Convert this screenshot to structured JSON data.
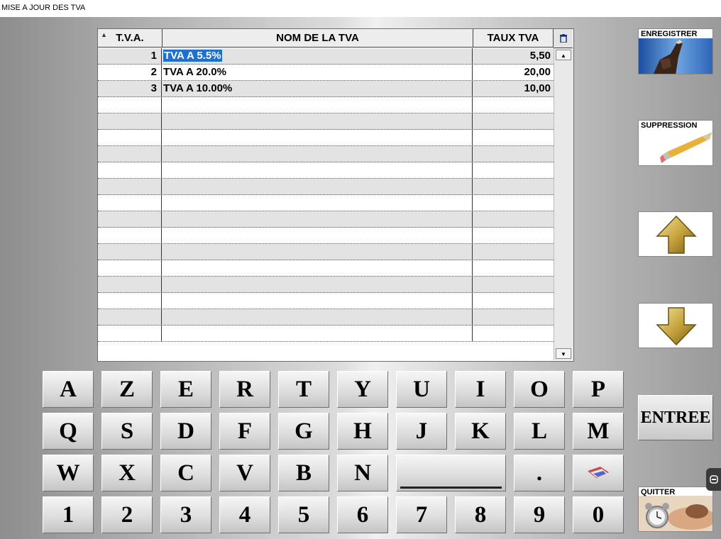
{
  "window": {
    "title": "MISE A JOUR DES TVA"
  },
  "grid": {
    "columns": [
      "T.V.A.",
      "NOM DE LA TVA",
      "TAUX TVA"
    ],
    "rows": [
      {
        "id": "1",
        "name": "TVA A 5.5%",
        "rate": "5,50",
        "selected": true
      },
      {
        "id": "2",
        "name": "TVA A 20.0%",
        "rate": "20,00",
        "selected": false
      },
      {
        "id": "3",
        "name": "TVA A 10.00%",
        "rate": "10,00",
        "selected": false
      }
    ],
    "empty_rows": 15
  },
  "keyboard": {
    "row1": [
      "A",
      "Z",
      "E",
      "R",
      "T",
      "Y",
      "U",
      "I",
      "O",
      "P"
    ],
    "row2": [
      "Q",
      "S",
      "D",
      "F",
      "G",
      "H",
      "J",
      "K",
      "L",
      "M"
    ],
    "row3": [
      "W",
      "X",
      "C",
      "V",
      "B",
      "N"
    ],
    "dot": ".",
    "row4": [
      "1",
      "2",
      "3",
      "4",
      "5",
      "6",
      "7",
      "8",
      "9",
      "0"
    ]
  },
  "buttons": {
    "save": "ENREGISTRER",
    "delete": "SUPPRESSION",
    "enter": "ENTREE",
    "quit": "QUITTER"
  },
  "icons": {
    "sort": "sort-up-icon",
    "trash": "trash-icon",
    "up": "arrow-up-icon",
    "down": "arrow-down-icon",
    "eraser": "eraser-icon",
    "hand": "hand-pointing-icon",
    "clock": "alarm-clock-icon"
  },
  "colors": {
    "selection": "#1f6fd0",
    "arrow_gold": "#c9a640"
  }
}
